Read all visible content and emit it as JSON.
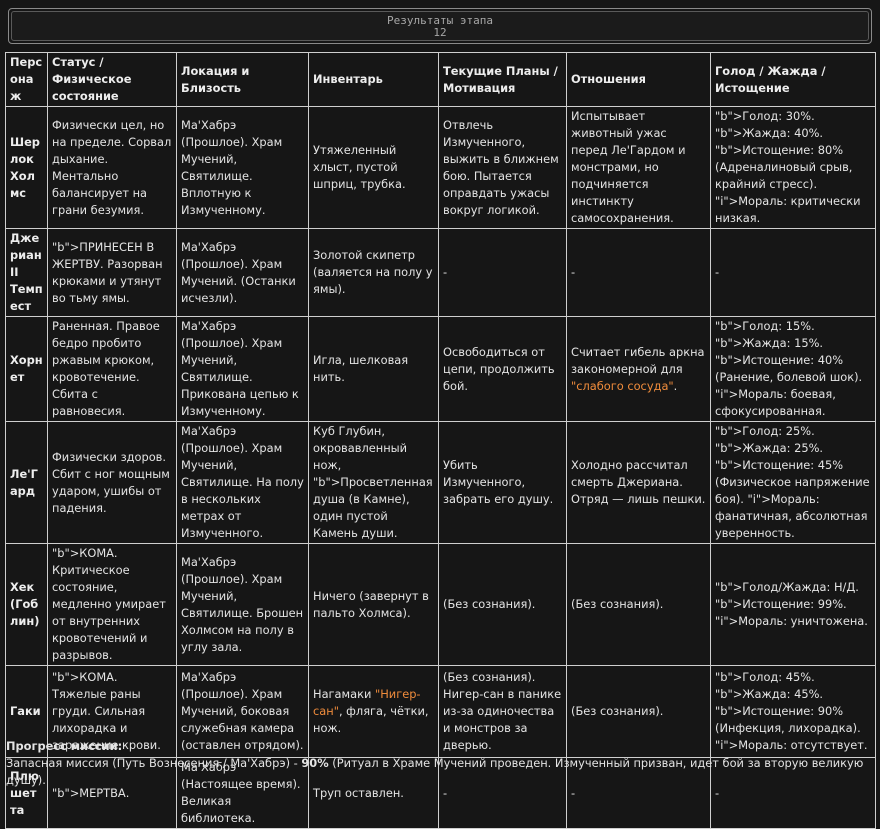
{
  "header": {
    "title": "Результаты этапа",
    "stage": "12"
  },
  "table": {
    "columns": [
      "Персонаж",
      "Статус / Физическое состояние",
      "Локация и Близость",
      "Инвентарь",
      "Текущие Планы / Мотивация",
      "Отношения",
      "Голод / Жажда / Истощение"
    ],
    "rows": [
      {
        "name": "Шерлок Холмс",
        "status": "Физически цел, но на пределе. Сорвал дыхание. Ментально балансирует на грани безумия.",
        "location": "Ма'Хабрэ (Прошлое). Храм Мучений, Святилище. Вплотную к Измученному.",
        "inventory": "Утяжеленный хлыст, пустой шприц, трубка.",
        "plans": "Отвлечь Измученного, выжить в ближнем бою. Пытается оправдать ужасы вокруг логикой.",
        "relations": "Испытывает животный ужас перед Ле'Гардом и монстрами, но подчиняется инстинкту самосохранения.",
        "needs": "Голод: 30%. Жажда: 40%. Истощение: 80% (Адреналиновый срыв, крайний стресс). Мораль: критически низкая."
      },
      {
        "name": "Джериан II Темпест",
        "status": "ПРИНЕСЕН В ЖЕРТВУ. Разорван крюками и утянут во тьму ямы.",
        "location": "Ма'Хабрэ (Прошлое). Храм Мучений. (Останки исчезли).",
        "inventory": "Золотой скипетр (валяется на полу у ямы).",
        "plans": "-",
        "relations": "-",
        "needs": "-"
      },
      {
        "name": "Хорнет",
        "status": "Раненная. Правое бедро пробито ржавым крюком, кровотечение. Сбита с равновесия.",
        "location": "Ма'Хабрэ (Прошлое). Храм Мучений, Святилище. Прикована цепью к Измученному.",
        "inventory": "Игла, шелковая нить.",
        "plans": "Освободиться от цепи, продолжить бой.",
        "relations": "Считает гибель аркна закономерной для \"слабого сосуда\".",
        "needs": "Голод: 15%. Жажда: 15%. Истощение: 40% (Ранение, болевой шок). Мораль: боевая, сфокусированная."
      },
      {
        "name": "Ле'Гард",
        "status": "Физически здоров. Сбит с ног мощным ударом, ушибы от падения.",
        "location": "Ма'Хабрэ (Прошлое). Храм Мучений, Святилище. На полу в нескольких метрах от Измученного.",
        "inventory": "Куб Глубин, окровавленный нож, Просветленная душа (в Камне), один пустой Камень души.",
        "plans": "Убить Измученного, забрать его душу.",
        "relations": "Холодно рассчитал смерть Джериана. Отряд — лишь пешки.",
        "needs": "Голод: 25%. Жажда: 25%. Истощение: 45% (Физическое напряжение боя). Мораль: фанатичная, абсолютная уверенность."
      },
      {
        "name": "Хек (Гоблин)",
        "status": "КОМА. Критическое состояние, медленно умирает от внутренних кровотечений и разрывов.",
        "location": "Ма'Хабрэ (Прошлое). Храм Мучений, Святилище. Брошен Холмсом на полу в углу зала.",
        "inventory": "Ничего (завернут в пальто Холмса).",
        "plans": "(Без сознания).",
        "relations": "(Без сознания).",
        "needs": "Голод/Жажда: Н/Д. Истощение: 99%. Мораль: уничтожена."
      },
      {
        "name": "Гаки",
        "status": "КОМА. Тяжелые раны груди. Сильная лихорадка и заражение крови.",
        "location": "Ма'Хабрэ (Прошлое). Храм Мучений, боковая служебная камера (оставлен отрядом).",
        "inventory": "Нагамаки \"Нигер-сан\", фляга, чётки, нож.",
        "plans": "(Без сознания). Нигер-сан в панике из-за одиночества и монстров за дверью.",
        "relations": "(Без сознания).",
        "needs": "Голод: 45%. Жажда: 45%. Истощение: 90% (Инфекция, лихорадка). Мораль: отсутствует."
      },
      {
        "name": "Плюшетта",
        "status": "МЕРТВА.",
        "location": "Ма'Хабрэ (Настоящее время). Великая библиотека.",
        "inventory": "Труп оставлен.",
        "plans": "-",
        "relations": "-",
        "needs": "-"
      }
    ]
  },
  "progress": {
    "title": "Прогресс миссии:",
    "mission": "Запасная миссия (Путь Вознесения / Ма'Хабрэ) - ",
    "percent": "90%",
    "note": " (Ритуал в Храме Мучений проведен. Измученный призван, идет бой за вторую великую душу)."
  }
}
